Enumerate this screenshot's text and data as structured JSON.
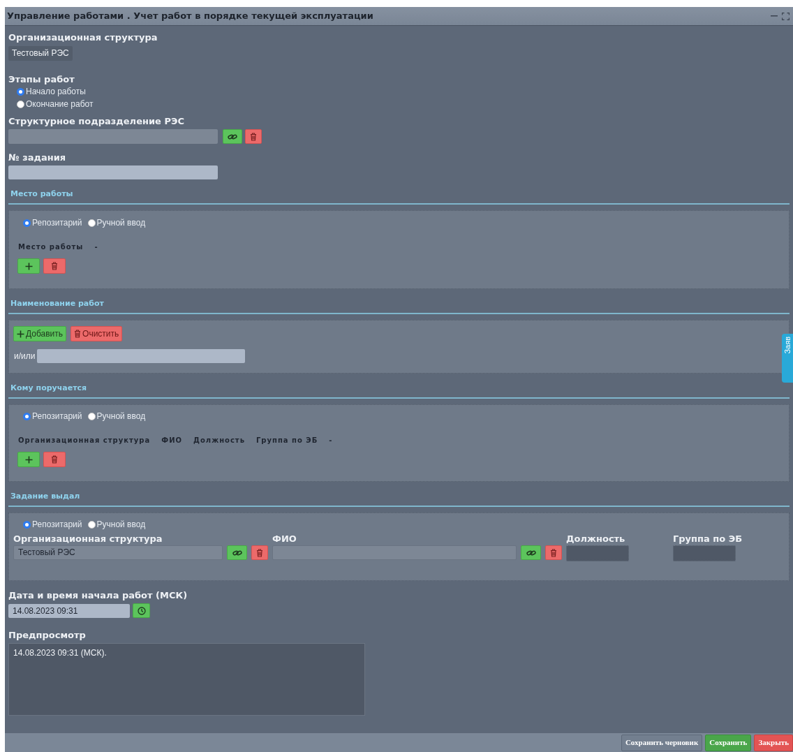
{
  "window": {
    "title": "Управление работами . Учет работ в порядке текущей эксплуатации"
  },
  "org_structure": {
    "label": "Организационная структура",
    "value": "Тестовый РЭС"
  },
  "stages": {
    "label": "Этапы работ",
    "options": [
      {
        "label": "Начало работы",
        "selected": true
      },
      {
        "label": "Окончание работ",
        "selected": false
      }
    ]
  },
  "subdivision": {
    "label": "Структурное подразделение РЭС"
  },
  "task_number": {
    "label": "№ задания"
  },
  "work_place": {
    "title": "Место работы",
    "source_options": [
      {
        "label": "Репозитарий",
        "selected": true
      },
      {
        "label": "Ручной ввод",
        "selected": false
      }
    ],
    "columns": [
      "Место работы",
      "-"
    ]
  },
  "work_name": {
    "title": "Наименование работ",
    "add_button": "Добавить",
    "clear_button": "Очистить",
    "or_label": "и/или"
  },
  "assignee": {
    "title": "Кому поручается",
    "source_options": [
      {
        "label": "Репозитарий",
        "selected": true
      },
      {
        "label": "Ручной ввод",
        "selected": false
      }
    ],
    "columns": [
      "Организационная структура",
      "ФИО",
      "Должность",
      "Группа по ЭБ",
      "-"
    ]
  },
  "issuer": {
    "title": "Задание выдал",
    "source_options": [
      {
        "label": "Репозитарий",
        "selected": true
      },
      {
        "label": "Ручной ввод",
        "selected": false
      }
    ],
    "fields": [
      {
        "label": "Организационная структура",
        "value": "Тестовый РЭС",
        "kind": "lookup"
      },
      {
        "label": "ФИО",
        "kind": "lookup"
      },
      {
        "label": "Должность",
        "kind": "readonly"
      },
      {
        "label": "Группа по ЭБ",
        "kind": "readonly"
      }
    ]
  },
  "start_datetime": {
    "label": "Дата и время начала работ (МСК)",
    "value": "14.08.2023 09:31"
  },
  "preview": {
    "label": "Предпросмотр",
    "value": "14.08.2023 09:31 (МСК)."
  },
  "side_tab": {
    "label": "Заяв"
  },
  "footer_buttons": [
    {
      "label": "Сохранить черновик",
      "kind": "neutral"
    },
    {
      "label": "Сохранить",
      "kind": "save"
    },
    {
      "label": "Закрыть",
      "kind": "close"
    }
  ]
}
